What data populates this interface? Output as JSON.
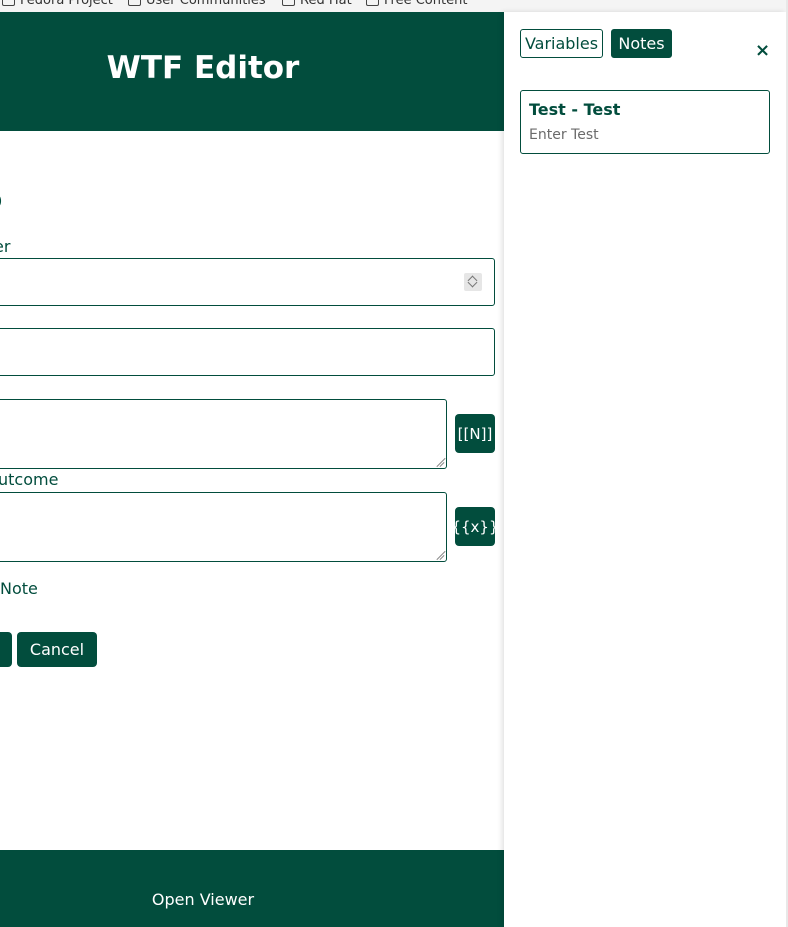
{
  "bookmarks": [
    "Fedora Project",
    "User Communities",
    "Red Hat",
    "Free Content"
  ],
  "editor": {
    "title": "WTF Editor",
    "section_title": "ep",
    "fields": {
      "number_label": "er",
      "outcome_label": "utcome",
      "note_label": "Note"
    },
    "buttons": {
      "insert_note_ref": "[[N]]",
      "insert_variable": "{{x}}",
      "cancel": "Cancel"
    },
    "footer_link": "Open Viewer"
  },
  "panel": {
    "tabs": [
      {
        "label": "Variables",
        "active": false
      },
      {
        "label": "Notes",
        "active": true
      }
    ],
    "close_icon": "×",
    "notes": [
      {
        "title": "Test - Test",
        "placeholder": "Enter Test"
      }
    ]
  },
  "colors": {
    "accent": "#024d3d",
    "background": "#ffffff"
  }
}
